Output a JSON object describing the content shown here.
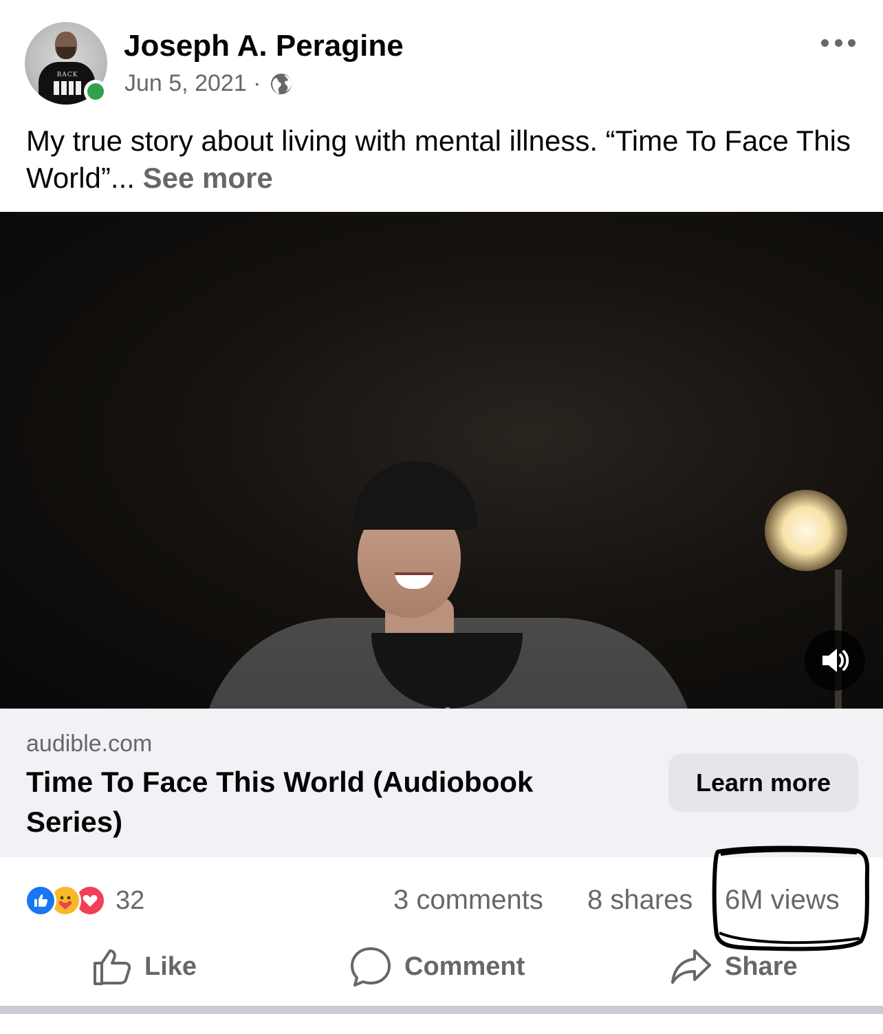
{
  "post": {
    "author": "Joseph A. Peragine",
    "date": "Jun 5, 2021 ·",
    "audience_icon": "globe-icon",
    "text": "My true story about living with mental illness. “Time To Face This World”... ",
    "see_more": "See more",
    "avatar_shirt_text": "BACK"
  },
  "video": {
    "sound_icon": "speaker-icon"
  },
  "link_card": {
    "domain": "audible.com",
    "title": "Time To Face This World (Audiobook Series)",
    "button_label": "Learn more"
  },
  "stats": {
    "reaction_count": "32",
    "comments": "3 comments",
    "shares": "8 shares",
    "views": "6M views",
    "reaction_icons": [
      "like-reaction-icon",
      "care-reaction-icon",
      "love-reaction-icon"
    ]
  },
  "actions": {
    "like": "Like",
    "comment": "Comment",
    "share": "Share"
  },
  "colors": {
    "secondary_text": "#65676b",
    "like_blue": "#1877f2",
    "online_green": "#31a24c",
    "card_bg": "#f0f2f5"
  }
}
